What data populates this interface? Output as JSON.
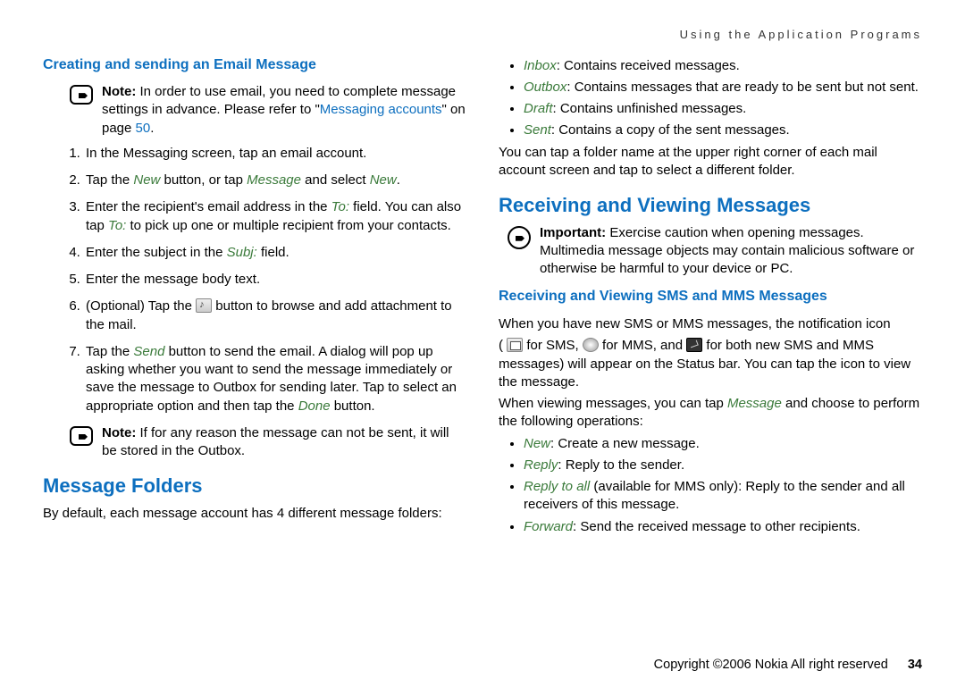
{
  "header": "Using the Application Programs",
  "left": {
    "heading1": "Creating and sending an Email Message",
    "note1": {
      "label": "Note:",
      "pre": " In order to use email, you need to complete message settings in advance. Please refer to \"",
      "link": "Messaging accounts",
      "post": "\" on page ",
      "page": "50",
      "end": "."
    },
    "steps": {
      "s1": "In the Messaging screen, tap an email account.",
      "s2a": "Tap the ",
      "s2b": "New",
      "s2c": " button, or tap ",
      "s2d": "Message",
      "s2e": " and select ",
      "s2f": "New",
      "s2g": ".",
      "s3a": "Enter the recipient's email address in the ",
      "s3b": "To:",
      "s3c": " field. You can also tap ",
      "s3d": "To:",
      "s3e": " to pick up one or multiple recipient from your contacts.",
      "s4a": "Enter the subject in the ",
      "s4b": "Subj:",
      "s4c": " field.",
      "s5": "Enter the message body text.",
      "s6a": "(Optional) Tap the ",
      "s6b": " button to browse and add attachment to the mail.",
      "s7a": "Tap the ",
      "s7b": "Send",
      "s7c": " button to send the email. A dialog will pop up asking whether you want to send the message immediately or save the message to Outbox for sending later. Tap to select an appropriate option and then tap the ",
      "s7d": "Done",
      "s7e": " button."
    },
    "note2": {
      "label": "Note:",
      "text": " If for any reason the message can not be sent, it will be stored in the Outbox."
    },
    "heading2": "Message Folders",
    "body2": "By default, each message account has 4 different message folders:"
  },
  "right": {
    "folders": {
      "f1a": "Inbox",
      "f1b": ": Contains received messages.",
      "f2a": "Outbox",
      "f2b": ": Contains messages that are ready to be sent but not sent.",
      "f3a": "Draft",
      "f3b": ": Contains unfinished messages.",
      "f4a": "Sent",
      "f4b": ": Contains a copy of the sent messages."
    },
    "foldersPost": "You can tap a folder name at the upper right corner of each mail account screen and tap to select a different folder.",
    "headingRV": "Receiving and Viewing Messages",
    "important": {
      "label": "Important:",
      "text": " Exercise caution when opening messages. Multimedia message objects may contain malicious software or otherwise be harmful to your device or PC."
    },
    "headingSMS": "Receiving and Viewing SMS and MMS Messages",
    "smsPara1": "When you have new SMS or MMS messages, the notification icon",
    "smsParaIcons": {
      "open": "( ",
      "t1": " for SMS, ",
      "t2": " for MMS, and ",
      "t3": " for both new SMS and MMS messages) will appear on the Status bar. You can tap the icon to view the message."
    },
    "smsPara2a": "When viewing messages, you can tap ",
    "smsPara2b": "Message",
    "smsPara2c": " and choose to perform the following operations:",
    "ops": {
      "o1a": "New",
      "o1b": ": Create a new message.",
      "o2a": "Reply",
      "o2b": ": Reply to the sender.",
      "o3a": "Reply to all",
      "o3b": " (available for MMS only): Reply to the sender and all receivers of this message.",
      "o4a": "Forward",
      "o4b": ": Send the received message to other recipients."
    }
  },
  "footer": {
    "copyright": "Copyright ©2006 Nokia All right reserved",
    "page": "34"
  }
}
